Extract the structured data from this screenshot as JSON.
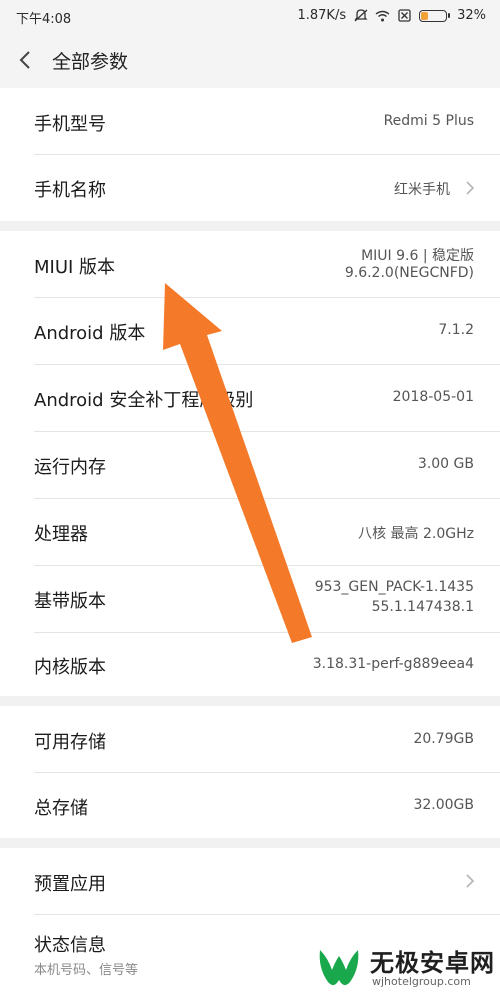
{
  "status_bar": {
    "time": "下午4:08",
    "speed": "1.87K/s",
    "battery_percent_label": "32%",
    "battery_level": 0.32,
    "icons": [
      "mute-icon",
      "wifi-icon",
      "sim-disabled-icon",
      "battery-icon"
    ]
  },
  "header": {
    "title": "全部参数",
    "back_icon": "chevron-left-icon"
  },
  "groups": [
    {
      "rows": [
        {
          "label": "手机型号",
          "value": "Redmi 5 Plus"
        },
        {
          "label": "手机名称",
          "value": "红米手机",
          "has_arrow": true
        }
      ]
    },
    {
      "rows": [
        {
          "label": "MIUI 版本",
          "value_line1": "MIUI 9.6 | 稳定版",
          "value_line2": "9.6.2.0(NEGCNFD)"
        },
        {
          "label": "Android 版本",
          "value": "7.1.2"
        },
        {
          "label": "Android 安全补丁程序级别",
          "value": "2018-05-01"
        },
        {
          "label": "运行内存",
          "value": "3.00 GB"
        },
        {
          "label": "处理器",
          "value": "八核 最高 2.0GHz"
        },
        {
          "label": "基带版本",
          "value_line1": "953_GEN_PACK-1.1435",
          "value_line2": "55.1.147438.1"
        },
        {
          "label": "内核版本",
          "value": "3.18.31-perf-g889eea4"
        }
      ]
    },
    {
      "rows": [
        {
          "label": "可用存储",
          "value": "20.79GB"
        },
        {
          "label": "总存储",
          "value": "32.00GB"
        }
      ]
    },
    {
      "rows": [
        {
          "label": "预置应用",
          "has_arrow": true
        },
        {
          "label": "状态信息",
          "sublabel": "本机号码、信号等"
        }
      ]
    }
  ],
  "annotation": {
    "color": "#f47a2a"
  },
  "watermark": {
    "brand": "无极安卓网",
    "url": "wjhotelgroup.com",
    "logo_color": "#1aa84c"
  }
}
